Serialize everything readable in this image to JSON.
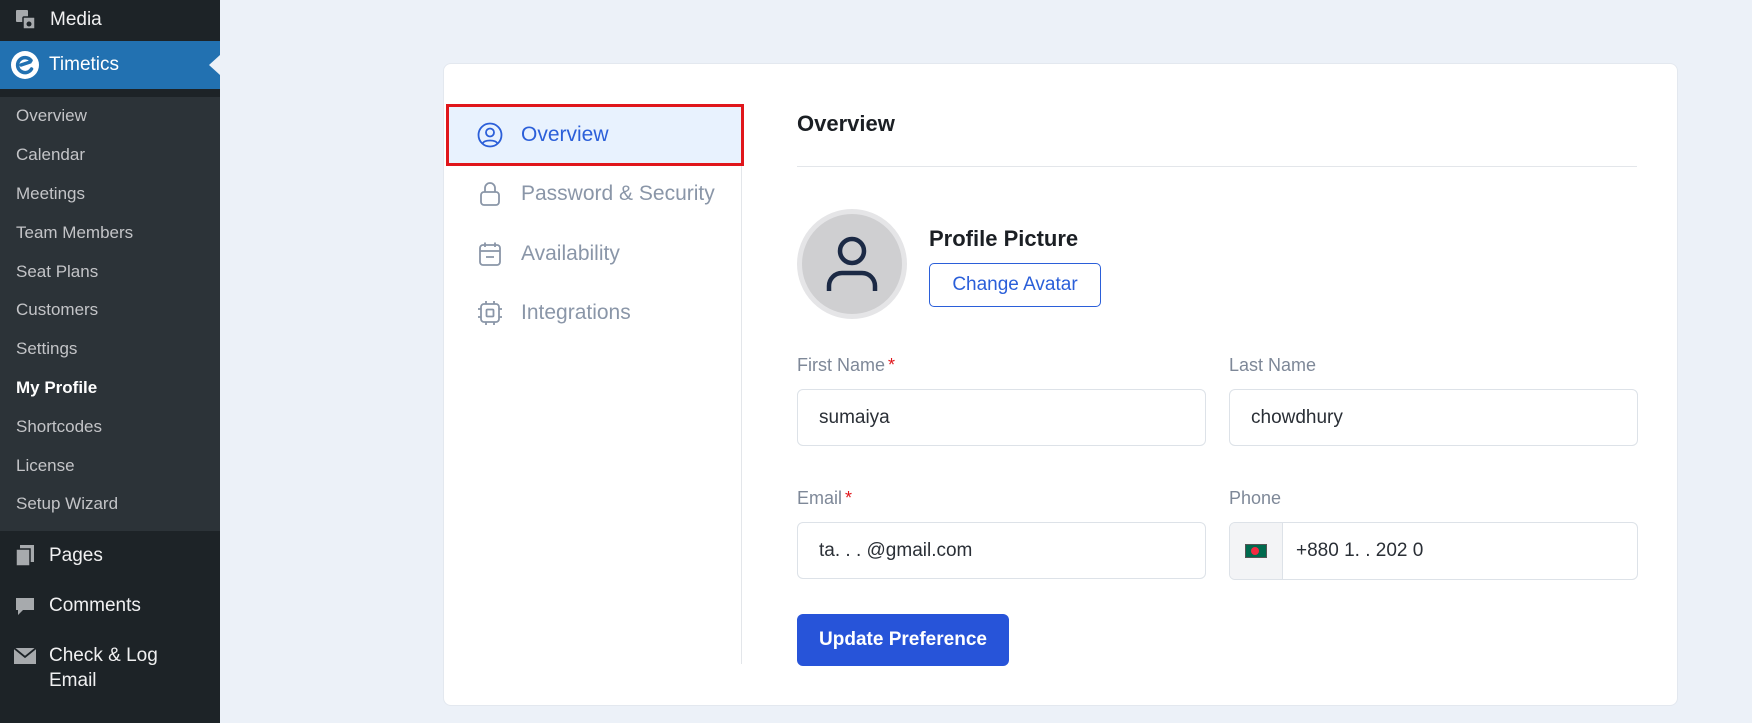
{
  "sidebar": {
    "top_item": {
      "label": "Media",
      "icon": "media-icon"
    },
    "current": {
      "label": "Timetics",
      "icon": "timetics-logo-icon"
    },
    "submenu": [
      {
        "label": "Overview"
      },
      {
        "label": "Calendar"
      },
      {
        "label": "Meetings"
      },
      {
        "label": "Team Members"
      },
      {
        "label": "Seat Plans"
      },
      {
        "label": "Customers"
      },
      {
        "label": "Settings"
      },
      {
        "label": "My Profile",
        "active": true
      },
      {
        "label": "Shortcodes"
      },
      {
        "label": "License"
      },
      {
        "label": "Setup Wizard"
      }
    ],
    "bottom_items": [
      {
        "label": "Pages",
        "icon": "pages-icon"
      },
      {
        "label": "Comments",
        "icon": "comments-icon"
      },
      {
        "label": "Check & Log Email",
        "icon": "email-icon"
      }
    ]
  },
  "tabs": [
    {
      "label": "Overview",
      "icon": "user-circle-icon",
      "active": true
    },
    {
      "label": "Password & Security",
      "icon": "lock-icon"
    },
    {
      "label": "Availability",
      "icon": "calendar-icon"
    },
    {
      "label": "Integrations",
      "icon": "chip-icon"
    }
  ],
  "content": {
    "title": "Overview",
    "profile_picture_label": "Profile Picture",
    "change_avatar_label": "Change Avatar",
    "first_name": {
      "label": "First Name",
      "required": "*",
      "value": "sumaiya"
    },
    "last_name": {
      "label": "Last Name",
      "value": "chowdhury"
    },
    "email": {
      "label": "Email",
      "required": "*",
      "value": "ta.              .  . @gmail.com"
    },
    "phone": {
      "label": "Phone",
      "value": "+880 1.         .  202 0"
    },
    "update_label": "Update Preference"
  },
  "colors": {
    "accent": "#2754d9",
    "wp_sidebar": "#1d2327",
    "wp_current": "#2271b1",
    "highlight_border": "#e0161b",
    "active_tab_bg": "#e8f2fe"
  }
}
